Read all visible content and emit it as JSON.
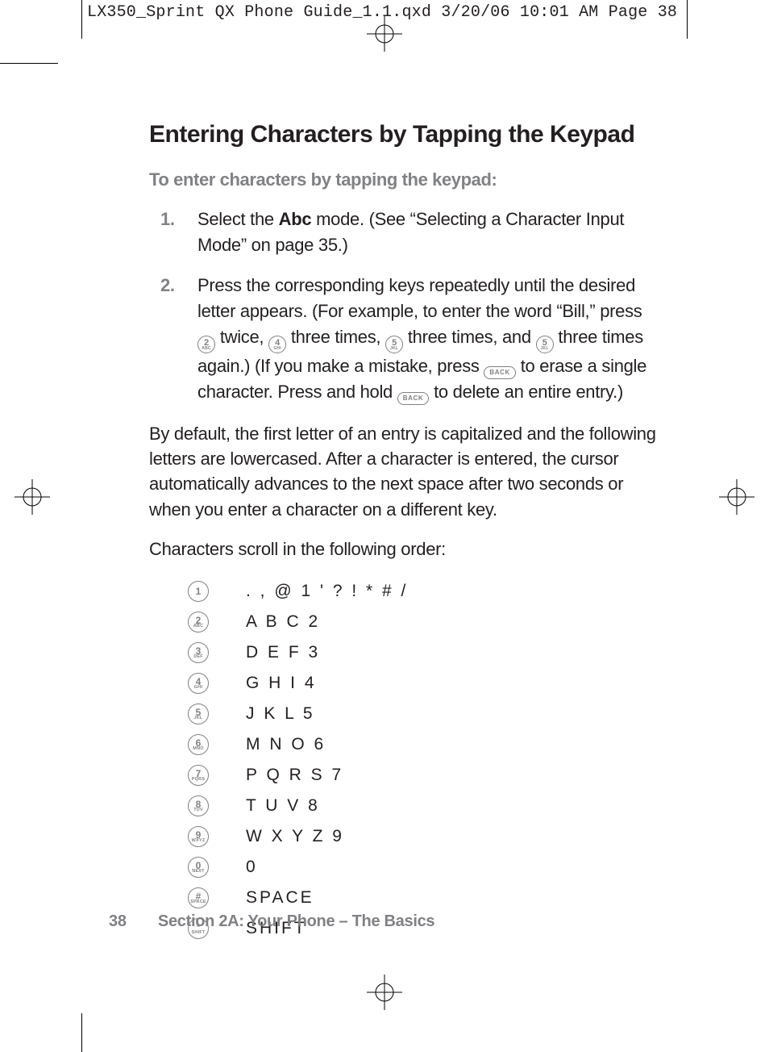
{
  "runhead": "LX350_Sprint QX Phone Guide_1.1.qxd  3/20/06  10:01 AM  Page 38",
  "title": "Entering Characters by Tapping the Keypad",
  "lead": "To enter characters by tapping the keypad:",
  "steps": [
    {
      "num": "1.",
      "pre": "Select the ",
      "bold": "Abc",
      "post": " mode. (See “Selecting a Character Input Mode” on page 35.)"
    },
    {
      "num": "2.",
      "seg_a": "Press the corresponding keys repeatedly until the desired letter appears. (For example, to enter the word “Bill,” press ",
      "seg_b": " twice, ",
      "seg_c": " three times, ",
      "seg_d": " three times, and ",
      "seg_e": " three times again.) (If you make a mistake, press ",
      "seg_f": " to erase a single character. Press and hold ",
      "seg_g": " to delete an entire entry.)"
    }
  ],
  "keys": {
    "k1": {
      "main": "1",
      "sub": ""
    },
    "k2": {
      "main": "2",
      "sub": "ABC"
    },
    "k3": {
      "main": "3",
      "sub": "DEF"
    },
    "k4": {
      "main": "4",
      "sub": "GHI"
    },
    "k5": {
      "main": "5",
      "sub": "JKL"
    },
    "k6": {
      "main": "6",
      "sub": "MNO"
    },
    "k7": {
      "main": "7",
      "sub": "PQRS"
    },
    "k8": {
      "main": "8",
      "sub": "TUV"
    },
    "k9": {
      "main": "9",
      "sub": "WXYZ"
    },
    "k0": {
      "main": "0",
      "sub": "NEXT"
    },
    "kpound": {
      "main": "#",
      "sub": "SPACE"
    },
    "kstar": {
      "main": "*",
      "sub": "SHIFT"
    },
    "back": "BACK"
  },
  "para1": "By default, the first letter of an entry is capitalized and the following letters are lowercased. After a character is entered, the cursor automatically advances to the next space after two seconds or when you enter a character on a different key.",
  "para2": "Characters scroll in the following order:",
  "charlist": [
    {
      "key": "k1",
      "chars": ". , @ 1 ' ? ! * # /"
    },
    {
      "key": "k2",
      "chars": "A B C 2"
    },
    {
      "key": "k3",
      "chars": "D E F 3"
    },
    {
      "key": "k4",
      "chars": "G H I 4"
    },
    {
      "key": "k5",
      "chars": "J K L 5"
    },
    {
      "key": "k6",
      "chars": "M N O 6"
    },
    {
      "key": "k7",
      "chars": "P Q R S 7"
    },
    {
      "key": "k8",
      "chars": "T U V 8"
    },
    {
      "key": "k9",
      "chars": "W X Y Z 9"
    },
    {
      "key": "k0",
      "chars": "0"
    },
    {
      "key": "kpound",
      "chars": "SPACE"
    },
    {
      "key": "kstar",
      "chars": "SHIFT"
    }
  ],
  "footer": {
    "page": "38",
    "section": "Section 2A: Your Phone – The Basics"
  }
}
